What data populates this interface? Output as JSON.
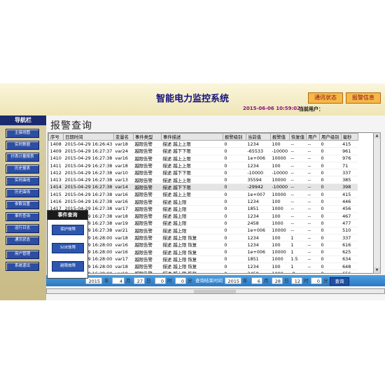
{
  "header": {
    "title": "智能电力监控系统",
    "btn_status": "通讯状态",
    "btn_alarm": "报警信息",
    "datetime": "2015-06-06 10:59:02",
    "current_user_label": "当前用户："
  },
  "sidebar": {
    "title": "导航栏",
    "items": [
      "主接线图",
      "实时数据",
      "抄表计量报表",
      "历史报表",
      "实时曲线",
      "历史曲线",
      "参数设置",
      "事件查询",
      "运行日志",
      "通讯状态",
      "用户管理",
      "系统退出"
    ]
  },
  "main": {
    "page_title": "报警查询"
  },
  "table": {
    "columns": [
      "序号",
      "日期时间",
      "变量名",
      "事件类型",
      "事件描述",
      "报警级别",
      "当前值",
      "报警值",
      "恢复值",
      "用户",
      "用户级别",
      "毫秒"
    ],
    "rows": [
      [
        "1408",
        "2015-04-29 16:26:43",
        "var18",
        "越限告警",
        "描述 越上上限",
        "0",
        "1234",
        "100",
        "--",
        "--",
        "0",
        "415"
      ],
      [
        "1409",
        "2015-04-29 16:27:37",
        "var24",
        "越限告警",
        "描述 越下下限",
        "0",
        "-65533",
        "-10000",
        "--",
        "--",
        "0",
        "961"
      ],
      [
        "1410",
        "2015-04-29 16:27:38",
        "var16",
        "越限告警",
        "描述 越上上限",
        "0",
        "1e+006",
        "10000",
        "--",
        "--",
        "0",
        "976"
      ],
      [
        "1411",
        "2015-04-29 16:27:38",
        "var18",
        "越限告警",
        "描述 越上上限",
        "0",
        "1234",
        "100",
        "--",
        "--",
        "0",
        "71"
      ],
      [
        "1412",
        "2015-04-29 16:27:38",
        "var10",
        "越限告警",
        "描述 越下下限",
        "0",
        "-10000",
        "-10000",
        "--",
        "--",
        "0",
        "337"
      ],
      [
        "1413",
        "2015-04-29 16:27:38",
        "var13",
        "越限告警",
        "描述 越上上限",
        "0",
        "35594",
        "10000",
        "--",
        "--",
        "0",
        "385"
      ],
      [
        "1414",
        "2015-04-29 16:27:38",
        "var14",
        "越限告警",
        "描述 越下下限",
        "0",
        "-29942",
        "-10000",
        "--",
        "--",
        "0",
        "398"
      ],
      [
        "1415",
        "2015-04-29 16:27:38",
        "var16",
        "越限告警",
        "描述 越上上限",
        "0",
        "1e+007",
        "10000",
        "--",
        "--",
        "0",
        "415"
      ],
      [
        "1416",
        "2015-04-29 16:27:38",
        "var16",
        "越限告警",
        "描述 越上限",
        "0",
        "1234",
        "100",
        "--",
        "--",
        "0",
        "446"
      ],
      [
        "1417",
        "2015-04-29 16:27:38",
        "var17",
        "越限告警",
        "描述 越上限",
        "0",
        "1851",
        "1000",
        "--",
        "--",
        "0",
        "456"
      ],
      [
        "1418",
        "2015-04-29 16:27:38",
        "var18",
        "越限告警",
        "描述 越上限",
        "0",
        "1234",
        "100",
        "--",
        "--",
        "0",
        "467"
      ],
      [
        "1419",
        "2015-04-29 16:27:38",
        "var19",
        "越限告警",
        "描述 越上限",
        "0",
        "2458",
        "1000",
        "--",
        "--",
        "0",
        "477"
      ],
      [
        "1420",
        "2015-04-29 16:27:38",
        "var21",
        "越限告警",
        "描述 越上限",
        "0",
        "1e+006",
        "10000",
        "--",
        "--",
        "0",
        "510"
      ],
      [
        "1421",
        "2015-04-29 16:28:00",
        "var18",
        "越限告警",
        "描述 越上限 恢复",
        "0",
        "1234",
        "100",
        "1",
        "--",
        "0",
        "337"
      ],
      [
        "1422",
        "2015-04-29 16:28:00",
        "var16",
        "越限告警",
        "描述 越上限 恢复",
        "0",
        "1234",
        "100",
        "1",
        "--",
        "0",
        "616"
      ],
      [
        "1423",
        "2015-04-29 16:28:00",
        "var16",
        "越限告警",
        "描述 越上限 恢复",
        "0",
        "1e+006",
        "10000",
        "1",
        "--",
        "0",
        "625"
      ],
      [
        "1424",
        "2015-04-29 16:28:00",
        "var17",
        "越限告警",
        "描述 越上限 恢复",
        "0",
        "1851",
        "1000",
        "1.5",
        "--",
        "0",
        "634"
      ],
      [
        "1425",
        "2015-04-29 16:28:00",
        "var18",
        "越限告警",
        "描述 越上限 恢复",
        "0",
        "1234",
        "100",
        "1",
        "--",
        "0",
        "648"
      ],
      [
        "1426",
        "2015-04-29 16:28:00",
        "var19",
        "越限告警",
        "描述 越上限 恢复",
        "0",
        "2458",
        "1000",
        "-8",
        "--",
        "0",
        "656"
      ],
      [
        "1427",
        "2015-04-29 16:28:00",
        "var13",
        "越限告警",
        "描述 越上限 恢复",
        "0",
        "1234",
        "1000",
        "--",
        "--",
        "0",
        "304"
      ]
    ]
  },
  "filter": {
    "start_year": "2015",
    "year_label": "年",
    "start_month": "4",
    "month_label": "月",
    "start_day": "27",
    "day_label": "日",
    "start_hour": "0",
    "hour_label": "时",
    "start_minute": "0",
    "minute_label": "分",
    "end_label": "查询结束时间",
    "end_year": "2015",
    "end_month": "6",
    "end_day": "28",
    "end_hour": "12",
    "end_minute": "0",
    "query_button": "查询"
  },
  "popup": {
    "title": "事件查询",
    "buttons": [
      "保护故障",
      "SOE故障",
      "越限故障"
    ]
  },
  "colors": {
    "header_bg": "#f5eec8",
    "nav_button": "#2c4ea3",
    "filter_bar": "#3a8bd2",
    "alarm_button": "#f7b84a"
  }
}
